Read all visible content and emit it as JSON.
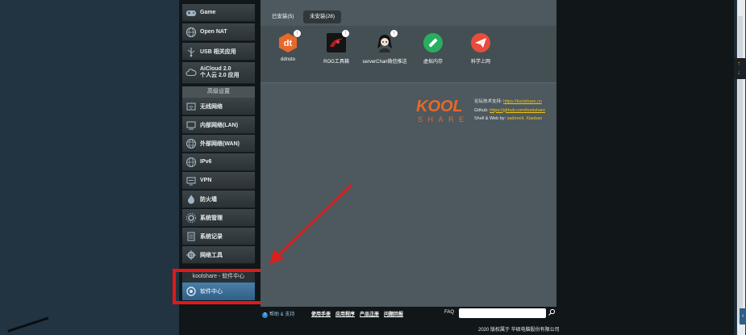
{
  "sidebar": {
    "top_items": [
      {
        "label": "Game",
        "icon": "gamepad-icon"
      },
      {
        "label": "Open NAT",
        "icon": "globe-network-icon"
      },
      {
        "label": "USB 相关应用",
        "icon": "usb-icon"
      },
      {
        "label_line1": "AiCloud 2.0",
        "label_line2": "个人云 2.0 应用",
        "icon": "cloud-icon"
      }
    ],
    "advanced_header": "高级设置",
    "advanced_items": [
      {
        "label": "无线网络",
        "icon": "wireless-icon"
      },
      {
        "label": "内部网络(LAN)",
        "icon": "lan-icon"
      },
      {
        "label": "外部网络(WAN)",
        "icon": "wan-globe-icon"
      },
      {
        "label": "IPv6",
        "icon": "ipv6-globe-icon"
      },
      {
        "label": "VPN",
        "icon": "vpn-icon"
      },
      {
        "label": "防火墙",
        "icon": "firewall-icon"
      },
      {
        "label": "系统管理",
        "icon": "admin-icon"
      },
      {
        "label": "系统记录",
        "icon": "log-icon"
      },
      {
        "label": "网络工具",
        "icon": "tools-icon"
      }
    ],
    "koolshare_header": "koolshare - 软件中心",
    "koolshare_item": {
      "label": "软件中心",
      "icon": "software-center-icon"
    }
  },
  "tabs": [
    {
      "label": "已安装(5)",
      "active": true
    },
    {
      "label": "未安装(28)",
      "active": false
    }
  ],
  "apps": [
    {
      "label": "ddnsto",
      "icon": "ddnsto-icon",
      "color": "#e8682a"
    },
    {
      "label": "ROG工具箱",
      "icon": "rog-icon",
      "color": "#b01e23"
    },
    {
      "label": "serverChan微信推送",
      "icon": "serverchan-icon",
      "color": "#ffffff"
    },
    {
      "label": "虚拟内存",
      "icon": "virtual-memory-icon",
      "color": "#27ae60"
    },
    {
      "label": "科学上网",
      "icon": "paper-plane-icon",
      "color": "#e74c3c"
    }
  ],
  "kool_logo": {
    "line1": "KOOL",
    "line2": "SHARE",
    "color": "#e8682a"
  },
  "credits": {
    "forum_label": "论坛技术支持:",
    "forum_link": "https://koolshare.cn",
    "github_label": "Github:",
    "github_link": "https://github.com/koolshare",
    "shell_label": "Shell & Web by:",
    "shell_authors": "sadoneli, Xiaobao"
  },
  "footer": {
    "help_label": "帮助 & 支持",
    "links": [
      "使用手册",
      "应用程序",
      "产品注册",
      "问题回报"
    ],
    "faq_label": "FAQ",
    "copyright": "2020 版权属于 华硕电脑股份有限公司"
  }
}
